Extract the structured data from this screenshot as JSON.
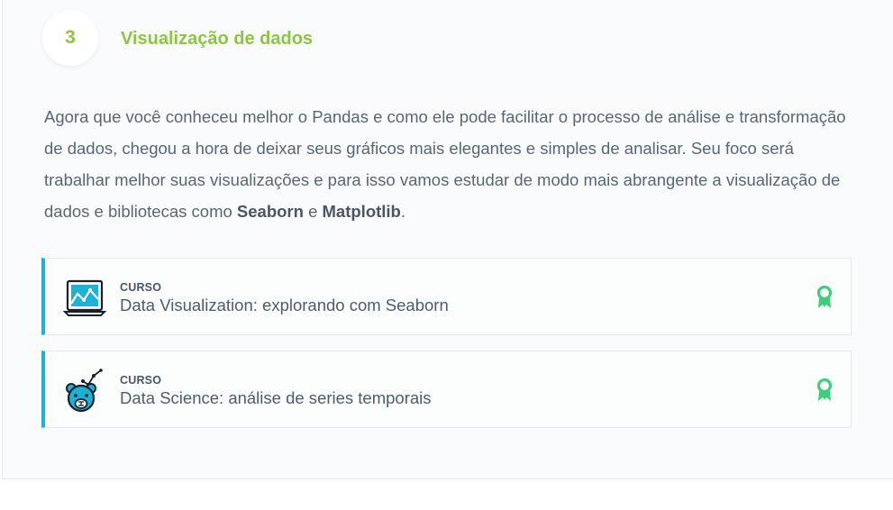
{
  "step": {
    "number": "3",
    "title": "Visualização de dados"
  },
  "description": {
    "line1": "Agora que você conheceu melhor o Pandas e como ele pode facilitar o processo de análise e transformação de dados, chegou a hora de deixar seus gráficos mais elegantes e simples de analisar. Seu foco será trabalhar melhor suas visualizações e para isso vamos estudar de modo mais abrangente a visualização de dados e bibliotecas como ",
    "bold1": "Seaborn",
    "connector": " e ",
    "bold2": "Matplotlib",
    "end": "."
  },
  "courses": [
    {
      "kind": "CURSO",
      "name": "Data Visualization: explorando com Seaborn",
      "icon": "chart-window-icon"
    },
    {
      "kind": "CURSO",
      "name": "Data Science: análise de series temporais",
      "icon": "bear-chart-icon"
    }
  ],
  "colors": {
    "accent_green": "#8cc63f",
    "card_border": "#1bb2d6",
    "badge_green": "#3ecf7a"
  }
}
